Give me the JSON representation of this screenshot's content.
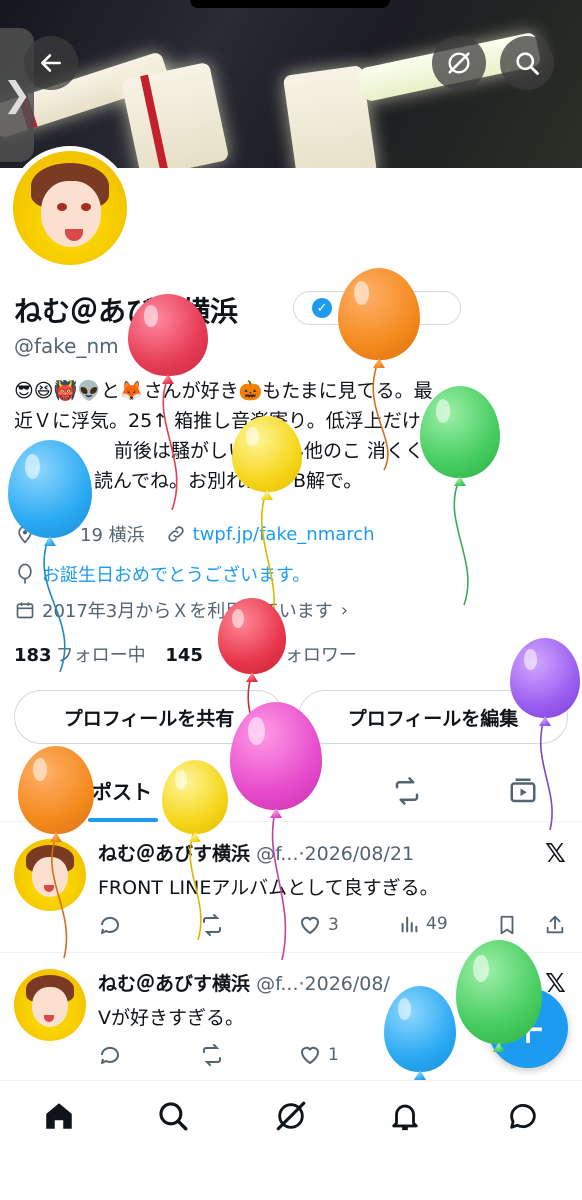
{
  "header": {
    "back_icon": "arrow-left-icon",
    "grok_icon": "grok-icon",
    "search_icon": "search-icon",
    "side_tab_glyph": "❯"
  },
  "profile": {
    "name": "ねむ＠あびす横浜",
    "verify_label": "ける",
    "handle": "@fake_nm",
    "bio_line1": "😎😆👹👽と🦊さんが好き🎃もたまに見てる。最",
    "bio_line2": "近Ｖに浮気。25↑ 箱推し音楽寄り。低浮上だけど",
    "bio_line3": "前後は騒がしいならん他のこ  消くく。ツ",
    "bio_line4": "読んでね。お別れはB→B解で。",
    "location": "19 横浜",
    "website": "twpf.jp/fake_nmarch",
    "birthday": "お誕生日おめでとうございます。",
    "joined": "2017年3月からＸを利用しています",
    "following_count": "183",
    "following_label": "フォロー中",
    "followers_count": "145",
    "followers_label": "フォロワー"
  },
  "buttons": {
    "share_profile": "プロフィールを共有",
    "edit_profile": "プロフィールを編集"
  },
  "tabs": {
    "posts": "ポスト"
  },
  "tweets": [
    {
      "name": "ねむ＠あびす横浜",
      "handle": "@f...",
      "date": "·2026/08/21",
      "text": "FRONT LINEアルバムとして良すぎる。",
      "likes": "3",
      "views": "49"
    },
    {
      "name": "ねむ＠あびす横浜",
      "handle": "@f...",
      "date": "·2026/08/",
      "text": "Vが好きすぎる。",
      "likes": "1",
      "views": "5"
    }
  ],
  "fab": {
    "label": "+"
  },
  "colors": {
    "accent": "#1d9bf0",
    "text": "#0f1419",
    "muted": "#536471"
  }
}
